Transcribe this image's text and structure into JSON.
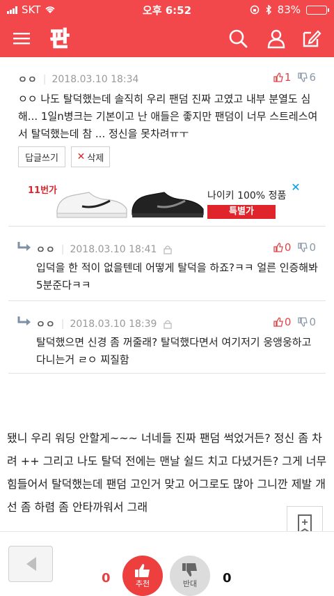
{
  "status": {
    "carrier": "SKT",
    "time": "오후 6:52",
    "battery": "83%",
    "battery_level": 0.83
  },
  "app": {
    "logo": "판"
  },
  "comments": [
    {
      "nick": "ㅇㅇ",
      "date": "2018.03.10 18:34",
      "up": "1",
      "down": "6",
      "text": "ㅇㅇ 나도 탈덕했는데 솔직히 우리 팬덤 진짜 고였고 내부 분열도 심해... 1일n병크는 기본이고 난 애들은 좋지만 팬덤이 너무 스트레스여서 탈덕했는데 참 ... 정신을 못차려ㅠㅜ",
      "reply_label": "답글쓰기",
      "delete_label": "삭제"
    },
    {
      "nick": "ㅇㅇ",
      "date": "2018.03.10 18:41",
      "up": "0",
      "down": "0",
      "text": "입덕을 한 적이 없을텐데 어떻게 탈덕을 하죠?ㅋㅋ 얼른 인증해봐 5분준다ㅋㅋ"
    },
    {
      "nick": "ㅇㅇ",
      "date": "2018.03.10 18:39",
      "up": "0",
      "down": "0",
      "text": "탈덕했으면 신경 좀 꺼줄래? 탈덕했다면서 여기저기 웅앵웅하고 다니는거 ㄹㅇ 찌질함"
    }
  ],
  "ad": {
    "brand_tag": "11번가",
    "title": "나이키 100% 정품",
    "badge": "특별가"
  },
  "post_text": "됐니 우리 워딩 안할게~~~ 너네들 진짜 팬덤 썩었거든? 정신 좀 차려 ++ 그리고 나도 탈덕 전에는 맨날 쉴드 치고 다녔거든? 그게 너무 힘들어서 탈덕했는데 팬덤 고인거 맞고 어그로도 많아 그니깐 제발 개선 좀 하렴 좀 안타까워서 그래",
  "bottom": {
    "up_count": "0",
    "down_count": "0",
    "up_label": "추천",
    "down_label": "반대"
  },
  "colors": {
    "brand": "#f2484c",
    "up": "#e24246",
    "down": "#8a98a8"
  }
}
